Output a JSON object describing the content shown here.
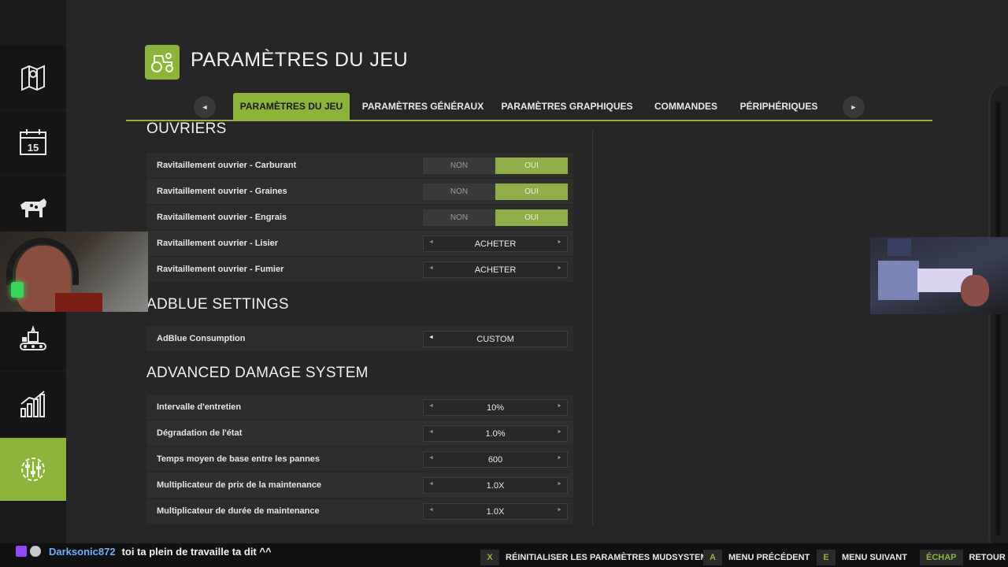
{
  "page": {
    "title": "PARAMÈTRES DU JEU"
  },
  "tabs": [
    {
      "label": "PARAMÈTRES DU JEU",
      "active": true
    },
    {
      "label": "PARAMÈTRES GÉNÉRAUX",
      "active": false
    },
    {
      "label": "PARAMÈTRES GRAPHIQUES",
      "active": false
    },
    {
      "label": "COMMANDES",
      "active": false
    },
    {
      "label": "PÉRIPHÉRIQUES",
      "active": false
    }
  ],
  "tab_nav": {
    "prev": "◄",
    "next": "►"
  },
  "sidebar": {
    "items": [
      {
        "icon": "map-icon"
      },
      {
        "icon": "calendar-icon",
        "text": "15"
      },
      {
        "icon": "cow-icon"
      },
      {
        "icon": "hidden-icon"
      },
      {
        "icon": "production-icon"
      },
      {
        "icon": "statistics-icon"
      },
      {
        "icon": "settings-sliders-icon",
        "active": true
      }
    ]
  },
  "sections": {
    "ouvriers": {
      "title": "OUVRIERS",
      "rows": [
        {
          "label": "Ravitaillement ouvrier - Carburant",
          "type": "toggle",
          "off": "NON",
          "on": "OUI"
        },
        {
          "label": "Ravitaillement ouvrier - Graines",
          "type": "toggle",
          "off": "NON",
          "on": "OUI"
        },
        {
          "label": "Ravitaillement ouvrier - Engrais",
          "type": "toggle",
          "off": "NON",
          "on": "OUI"
        },
        {
          "label": "Ravitaillement ouvrier - Lisier",
          "type": "select",
          "value": "ACHETER"
        },
        {
          "label": "Ravitaillement ouvrier - Fumier",
          "type": "select",
          "value": "ACHETER"
        }
      ]
    },
    "adblue": {
      "title": "ADBLUE SETTINGS",
      "rows": [
        {
          "label": "AdBlue Consumption",
          "type": "select",
          "value": "CUSTOM"
        }
      ]
    },
    "damage": {
      "title": "ADVANCED DAMAGE SYSTEM",
      "rows": [
        {
          "label": "Intervalle d'entretien",
          "type": "select",
          "value": "10%"
        },
        {
          "label": "Dégradation de l'état",
          "type": "select",
          "value": "1.0%"
        },
        {
          "label": "Temps moyen de base entre les pannes",
          "type": "select",
          "value": "600"
        },
        {
          "label": "Multiplicateur de prix de la maintenance",
          "type": "select",
          "value": "1.0X"
        },
        {
          "label": "Multiplicateur de durée de maintenance",
          "type": "select",
          "value": "1.0X"
        }
      ]
    }
  },
  "select_arrows": {
    "left": "◄",
    "right": "►"
  },
  "chat": {
    "user": "Darksonic872",
    "message": "toi ta plein de travaille ta dit ^^"
  },
  "hints": [
    {
      "key": "X",
      "label": "RÉINITIALISER LES PARAMÈTRES MUDSYSTEM"
    },
    {
      "key": "A",
      "label": "MENU PRÉCÉDENT"
    },
    {
      "key": "E",
      "label": "MENU SUIVANT"
    },
    {
      "key": "ÉCHAP",
      "label": "RETOUR"
    }
  ],
  "colors": {
    "accent": "#8cb43a",
    "background": "#262626",
    "sidebar": "#151515"
  }
}
